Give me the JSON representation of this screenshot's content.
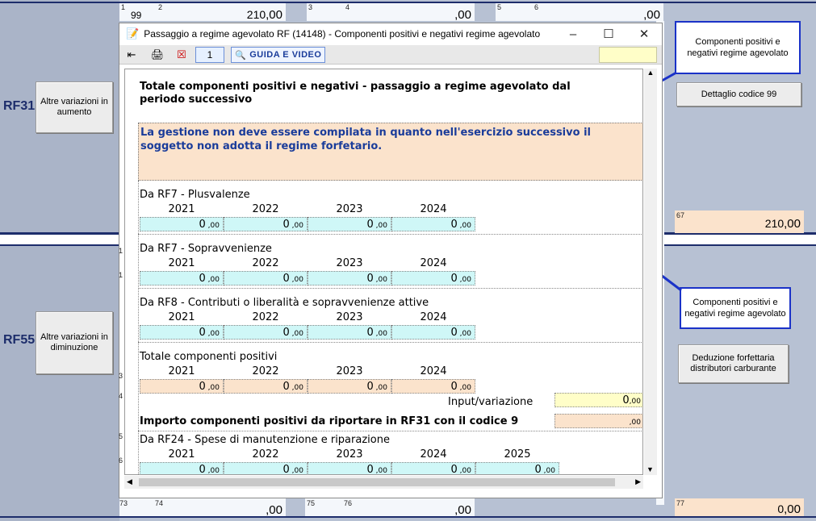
{
  "background": {
    "top_row": {
      "n1": "1",
      "v99": "99",
      "n2": "2",
      "amount2": "210",
      "cents": ",00",
      "n3": "3",
      "n4": "4",
      "amount4": ",00",
      "n5": "5",
      "n6": "6",
      "amount6": ",00"
    },
    "rf31": {
      "code": "RF31",
      "button": "Altre variazioni in aumento"
    },
    "rf55": {
      "code": "RF55",
      "button": "Altre variazioni in diminuzione"
    },
    "right_buttons": {
      "dettaglio": "Dettaglio codice 99",
      "deduzione": "Deduzione forfettaria distributori carburante"
    },
    "field67": {
      "num": "67",
      "int": "210",
      "cents": ",00"
    },
    "bottom_row": {
      "n73": "73",
      "n74": "74",
      "v74": ",00",
      "n75": "75",
      "n76": "76",
      "v76": ",00",
      "n77": "77",
      "v77_int": "0",
      "v77_cents": ",00"
    },
    "side_zero": "0",
    "left_digits": [
      "1",
      "1",
      "3",
      "4",
      "5",
      "6"
    ]
  },
  "callouts": {
    "top": "Componenti positivi e negativi regime agevolato",
    "middle": "Componenti positivi e negativi regime agevolato"
  },
  "window": {
    "title": "Passaggio a regime agevolato RF (14148) - Componenti positivi e negativi regime agevolato",
    "page_number": "1",
    "guida_label": "GUIDA E VIDEO",
    "heading": "Totale componenti positivi e negativi - passaggio a regime agevolato dal periodo successivo",
    "notice": "La gestione non deve essere compilata in quanto nell'esercizio successivo il soggetto non adotta il regime forfetario.",
    "sections": [
      {
        "label": "Da RF7 - Plusvalenze",
        "years": [
          "2021",
          "2022",
          "2023",
          "2024"
        ],
        "values": [
          "0",
          "0",
          "0",
          "0"
        ]
      },
      {
        "label": "Da RF7 - Sopravvenienze",
        "years": [
          "2021",
          "2022",
          "2023",
          "2024"
        ],
        "values": [
          "0",
          "0",
          "0",
          "0"
        ]
      },
      {
        "label": "Da RF8 - Contributi o liberalità e sopravvenienze attive",
        "years": [
          "2021",
          "2022",
          "2023",
          "2024"
        ],
        "values": [
          "0",
          "0",
          "0",
          "0"
        ]
      },
      {
        "label": "Totale componenti positivi",
        "years": [
          "2021",
          "2022",
          "2023",
          "2024"
        ],
        "values": [
          "0",
          "0",
          "0",
          "0"
        ]
      }
    ],
    "cents": ",00",
    "input_label": "Input/variazione",
    "input_value": "0",
    "importo_label": "Importo componenti positivi da riportare in RF31 con il codice 9",
    "importo_value": "",
    "rf24": {
      "label": "Da RF24 - Spese di manutenzione e riparazione",
      "years": [
        "2021",
        "2022",
        "2023",
        "2024",
        "2025"
      ],
      "values": [
        "0",
        "0",
        "0",
        "0",
        "0"
      ]
    }
  },
  "colors": {
    "accent": "#1a32c8",
    "cyan": "#cff7f7",
    "peach": "#fbe3cc",
    "navy": "#1d2d6b"
  }
}
